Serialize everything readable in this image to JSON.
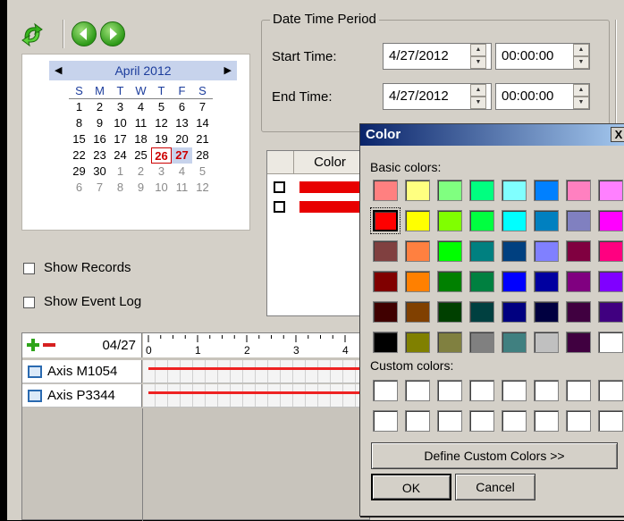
{
  "toolbar": {
    "icons": [
      "refresh-icon",
      "previous-icon",
      "next-icon"
    ]
  },
  "calendar": {
    "month_label": "April 2012",
    "day_headers": [
      "S",
      "M",
      "T",
      "W",
      "T",
      "F",
      "S"
    ],
    "weeks": [
      [
        "1",
        "2",
        "3",
        "4",
        "5",
        "6",
        "7"
      ],
      [
        "8",
        "9",
        "10",
        "11",
        "12",
        "13",
        "14"
      ],
      [
        "15",
        "16",
        "17",
        "18",
        "19",
        "20",
        "21"
      ],
      [
        "22",
        "23",
        "24",
        "25",
        "26",
        "27",
        "28"
      ],
      [
        "29",
        "30",
        "1",
        "2",
        "3",
        "4",
        "5"
      ],
      [
        "6",
        "7",
        "8",
        "9",
        "10",
        "11",
        "12"
      ]
    ],
    "today": "26",
    "selected": "27"
  },
  "options": {
    "show_records": "Show Records",
    "show_event_log": "Show Event Log"
  },
  "period": {
    "title": "Date Time Period",
    "start_label": "Start Time:",
    "start_date": "4/27/2012",
    "start_time": "00:00:00",
    "end_label": "End Time:",
    "end_date": "4/27/2012",
    "end_time": "00:00:00"
  },
  "records": {
    "color_header": "Color"
  },
  "timeline": {
    "date": "04/27",
    "ticks": [
      "0",
      "1",
      "2",
      "3",
      "4"
    ],
    "cameras": [
      "Axis M1054",
      "Axis P3344"
    ]
  },
  "color_dialog": {
    "title": "Color",
    "close": "X",
    "basic_label": "Basic colors:",
    "custom_label": "Custom colors:",
    "define_button": "Define Custom Colors >>",
    "ok": "OK",
    "cancel": "Cancel",
    "basic_colors": [
      "#ff8080",
      "#ffff80",
      "#80ff80",
      "#00ff80",
      "#80ffff",
      "#0080ff",
      "#ff80c0",
      "#ff80ff",
      "#ff0000",
      "#ffff00",
      "#80ff00",
      "#00ff40",
      "#00ffff",
      "#0080c0",
      "#8080c0",
      "#ff00ff",
      "#804040",
      "#ff8040",
      "#00ff00",
      "#008080",
      "#004080",
      "#8080ff",
      "#800040",
      "#ff0080",
      "#800000",
      "#ff8000",
      "#008000",
      "#008040",
      "#0000ff",
      "#0000a0",
      "#800080",
      "#8000ff",
      "#400000",
      "#804000",
      "#004000",
      "#004040",
      "#000080",
      "#000040",
      "#400040",
      "#400080",
      "#000000",
      "#808000",
      "#808040",
      "#808080",
      "#408080",
      "#c0c0c0",
      "#400040",
      "#ffffff"
    ],
    "selected_index": 8,
    "custom_colors": [
      "#ffffff",
      "#ffffff",
      "#ffffff",
      "#ffffff",
      "#ffffff",
      "#ffffff",
      "#ffffff",
      "#ffffff",
      "#ffffff",
      "#ffffff",
      "#ffffff",
      "#ffffff",
      "#ffffff",
      "#ffffff",
      "#ffffff",
      "#ffffff"
    ]
  }
}
